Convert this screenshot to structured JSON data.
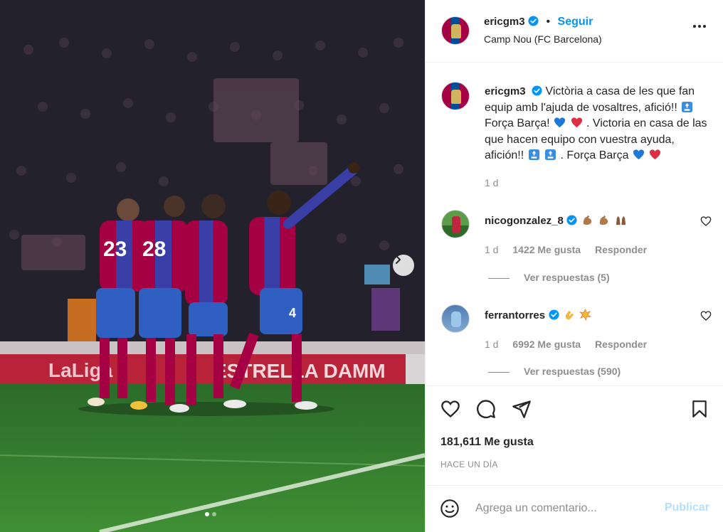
{
  "post": {
    "username": "ericgm3",
    "follow_label": "Seguir",
    "separator": "•",
    "location": "Camp Nou (FC Barcelona)",
    "caption": {
      "username": "ericgm3",
      "line1": "Victòria a casa de les que fan equip amb l'ajuda de vosaltres, afició!!",
      "line2": "Força Barça!",
      "line3": ". Victoria en casa de las que hacen equipo con vuestra ayuda, afición!!",
      "line4": ". Força Barça",
      "time": "1 d"
    },
    "comments": [
      {
        "username": "nicogonzalez_8",
        "emojis": [
          "flexed-biceps",
          "flexed-biceps",
          "raising-hands"
        ],
        "time": "1 d",
        "likes": "1422 Me gusta",
        "reply_label": "Responder",
        "replies_label": "Ver respuestas (5)"
      },
      {
        "username": "ferrantorres",
        "emojis": [
          "clapping-hands",
          "collision"
        ],
        "time": "1 d",
        "likes": "6992 Me gusta",
        "reply_label": "Responder",
        "replies_label": "Ver respuestas (590)"
      }
    ],
    "likes_count": "181,611 Me gusta",
    "time_ago": "HACE UN DÍA",
    "composer": {
      "placeholder": "Agrega un comentario...",
      "publish_label": "Publicar"
    }
  },
  "photo": {
    "carousel_index": 1,
    "carousel_total": 2,
    "banner_text": "ESTRELLA DAMM",
    "jersey_numbers": [
      "23",
      "28",
      "4"
    ]
  },
  "colors": {
    "accent": "#0095f6",
    "text": "#262626",
    "muted": "#8e8e8e",
    "publish_disabled": "#b2dffc",
    "barca_blue": "#004d98",
    "barca_red": "#a50044"
  }
}
